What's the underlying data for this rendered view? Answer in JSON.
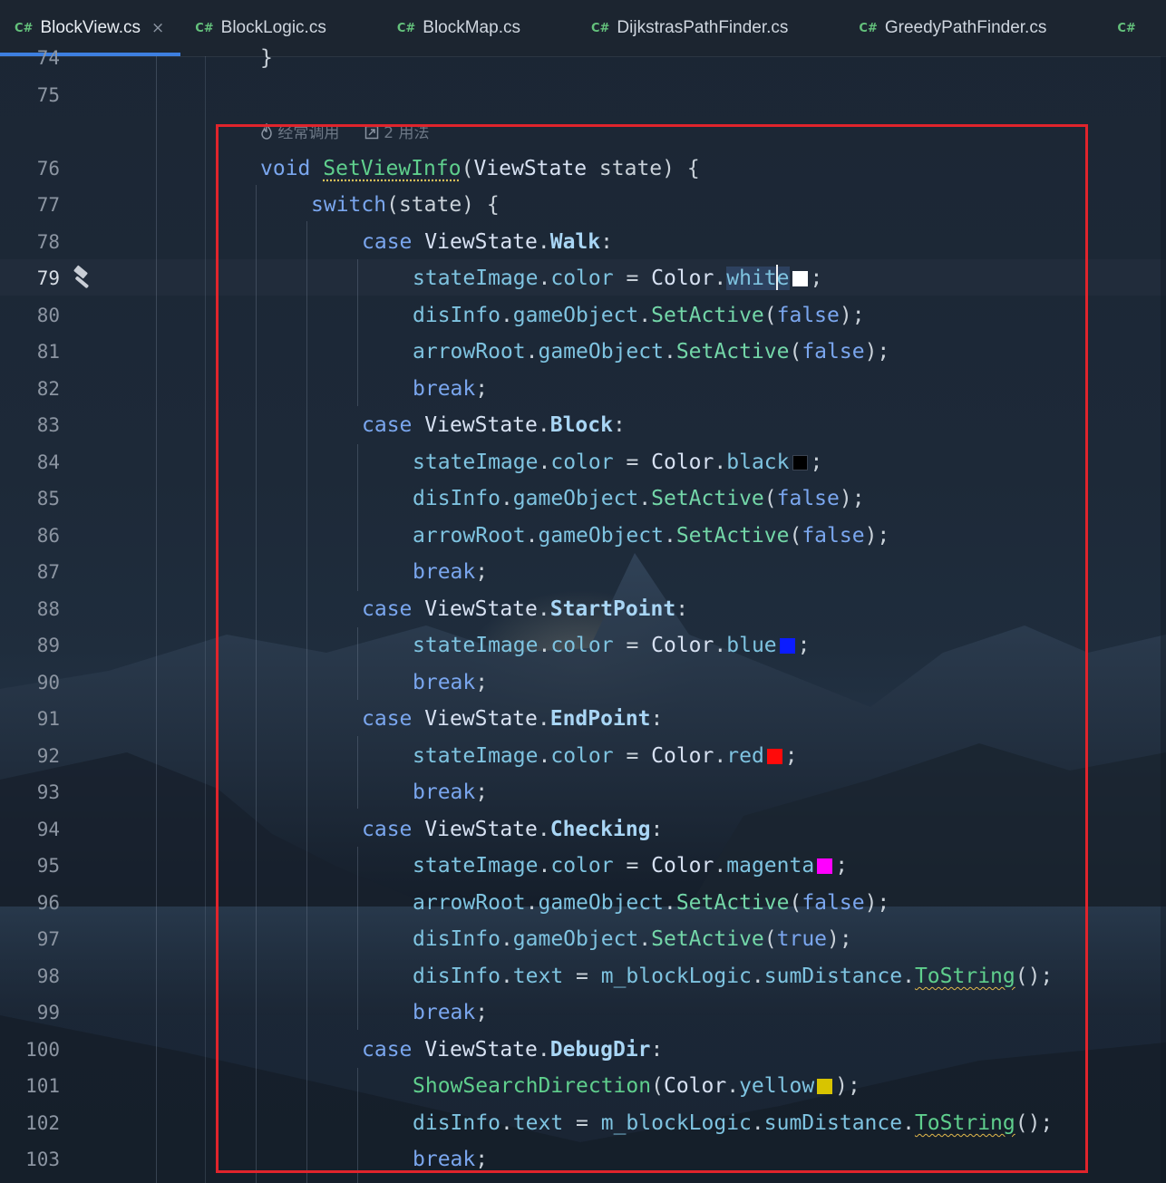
{
  "tabs": [
    {
      "lang": "C#",
      "label": "BlockView.cs",
      "active": true,
      "close": "×"
    },
    {
      "lang": "C#",
      "label": "BlockLogic.cs"
    },
    {
      "lang": "C#",
      "label": "BlockMap.cs"
    },
    {
      "lang": "C#",
      "label": "DijkstrasPathFinder.cs"
    },
    {
      "lang": "C#",
      "label": "GreedyPathFinder.cs"
    },
    {
      "lang": "C#",
      "label": ""
    }
  ],
  "hints": {
    "usage": "经常调用",
    "refs": "2 用法"
  },
  "line_numbers": [
    "74",
    "75",
    "76",
    "77",
    "78",
    "79",
    "80",
    "81",
    "82",
    "83",
    "84",
    "85",
    "86",
    "87",
    "88",
    "89",
    "90",
    "91",
    "92",
    "93",
    "94",
    "95",
    "96",
    "97",
    "98",
    "99",
    "100",
    "101",
    "102",
    "103"
  ],
  "current_line": "79",
  "code": {
    "l74": "}",
    "l76": {
      "kw": "void",
      "fn": "SetViewInfo",
      "p1": "(",
      "ty": "ViewState",
      "p2": " state) {"
    },
    "l77": {
      "kw": "switch",
      "p": "(state) {"
    },
    "cases": [
      {
        "kw": "case",
        "ty": "ViewState",
        "dot": ".",
        "member": "Walk",
        "colon": ":"
      },
      {
        "kw": "case",
        "ty": "ViewState",
        "dot": ".",
        "member": "Block",
        "colon": ":"
      },
      {
        "kw": "case",
        "ty": "ViewState",
        "dot": ".",
        "member": "StartPoint",
        "colon": ":"
      },
      {
        "kw": "case",
        "ty": "ViewState",
        "dot": ".",
        "member": "EndPoint",
        "colon": ":"
      },
      {
        "kw": "case",
        "ty": "ViewState",
        "dot": ".",
        "member": "Checking",
        "colon": ":"
      },
      {
        "kw": "case",
        "ty": "ViewState",
        "dot": ".",
        "member": "DebugDir",
        "colon": ":"
      }
    ],
    "stateImage": "stateImage",
    "color_prop": "color",
    "assign": " = ",
    "Color": "Color",
    "disInfo": "disInfo",
    "arrowRoot": "arrowRoot",
    "gameObject": "gameObject",
    "SetActive": "SetActive",
    "false": "false",
    "true": "true",
    "break": "break",
    "text": "text",
    "m_blockLogic": "m_blockLogic",
    "sumDistance": "sumDistance",
    "ToString": "ToString",
    "ShowSearchDirection": "ShowSearchDirection",
    "colors": {
      "white": {
        "name": "white",
        "hex": "#ffffff"
      },
      "black": {
        "name": "black",
        "hex": "#000000"
      },
      "blue": {
        "name": "blue",
        "hex": "#0000ff"
      },
      "red": {
        "name": "red",
        "hex": "#ff0000"
      },
      "magenta": {
        "name": "magenta",
        "hex": "#ff00ff"
      },
      "yellow": {
        "name": "yellow",
        "hex": "#e1cb00"
      }
    }
  },
  "icons": {
    "gutter": "hammer-icon",
    "usage": "flame-icon",
    "refs": "external-link-icon"
  },
  "highlight_box_color": "#e0242c"
}
